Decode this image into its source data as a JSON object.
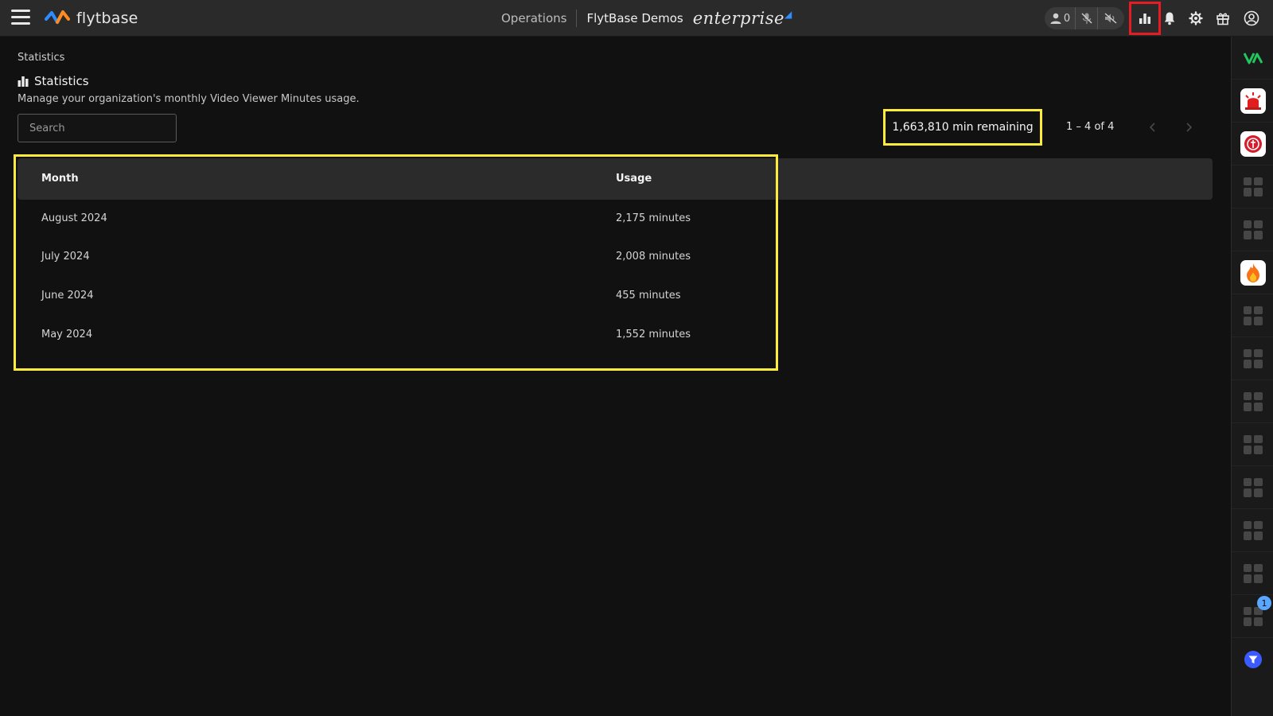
{
  "header": {
    "brand": "flytbase",
    "nav_operations": "Operations",
    "org_name": "FlytBase Demos",
    "edition": "enterprise",
    "user_count": "0"
  },
  "page": {
    "breadcrumb": "Statistics",
    "title": "Statistics",
    "subtitle": "Manage your organization's monthly Video Viewer Minutes usage."
  },
  "search": {
    "placeholder": "Search",
    "value": ""
  },
  "summary": {
    "remaining": "1,663,810 min remaining",
    "range": "1 – 4 of 4"
  },
  "table": {
    "columns": [
      "Month",
      "Usage"
    ],
    "rows": [
      {
        "month": "August 2024",
        "usage": "2,175 minutes"
      },
      {
        "month": "July 2024",
        "usage": "2,008 minutes"
      },
      {
        "month": "June 2024",
        "usage": "455 minutes"
      },
      {
        "month": "May 2024",
        "usage": "1,552 minutes"
      }
    ]
  },
  "rail": {
    "notification_badge": "1"
  },
  "colors": {
    "highlight": "#ffeb3b",
    "active_outline": "#e51c23",
    "background": "#111111",
    "topbar": "#2a2a2a"
  },
  "icons": {
    "menu": "hamburger-icon",
    "user": "user-icon",
    "mic": "mic-off-icon",
    "speaker": "speaker-off-icon",
    "stats": "bar-chart-icon",
    "bell": "bell-icon",
    "settings": "gear-icon",
    "gift": "gift-icon",
    "profile": "account-circle-icon"
  }
}
